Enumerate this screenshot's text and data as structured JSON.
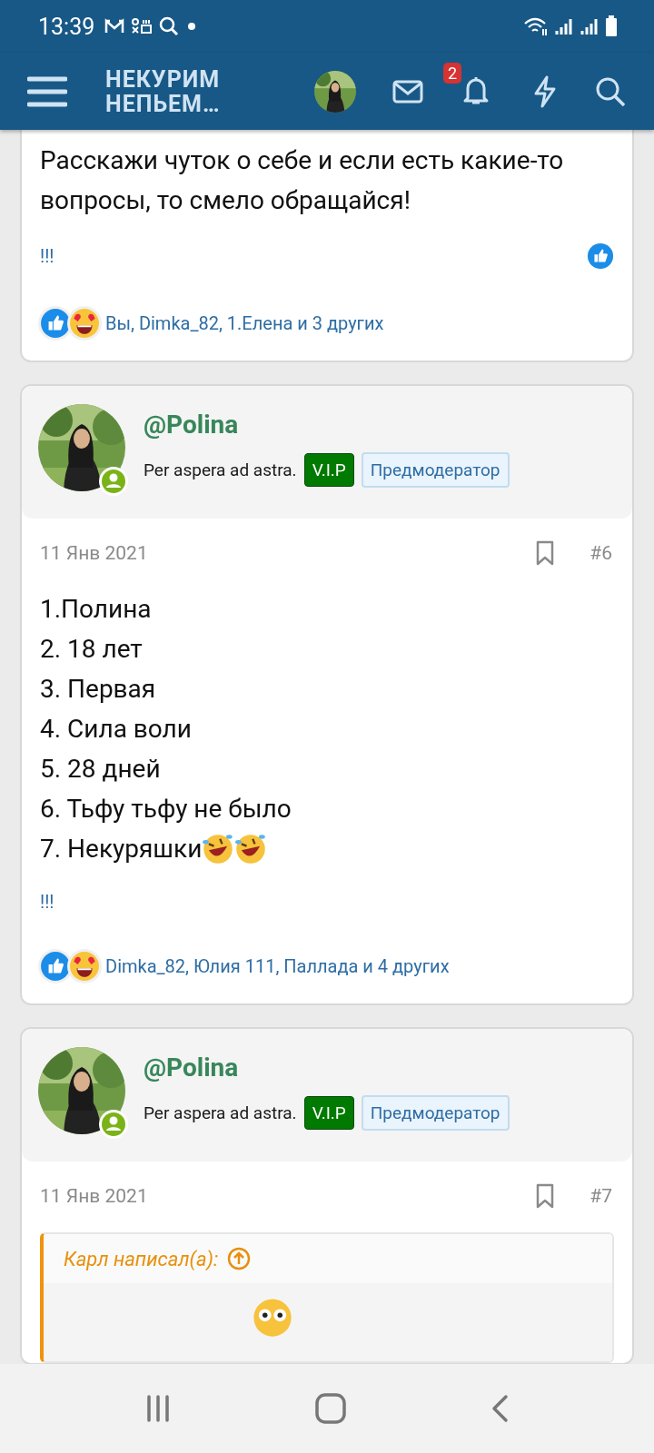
{
  "status_bar": {
    "time": "13:39"
  },
  "header": {
    "logo_lines": [
      "НЕКУРИМ",
      "НЕПЬЕМ…"
    ],
    "notification_count": "2"
  },
  "posts": [
    {
      "kind": "partial",
      "body": [
        {
          "text": "Расскажи чуток о себе и если есть какие-то вопросы, то смело обращайся!"
        }
      ],
      "signature": "!!!",
      "reacted": true,
      "reactions_text": "Вы, Dimka_82, 1.Елена и 3 других"
    },
    {
      "kind": "full",
      "author": "@Polina",
      "tagline": "Per aspera ad astra.",
      "badges": [
        {
          "label": "V.I.P",
          "kind": "vip"
        },
        {
          "label": "Предмодератор",
          "kind": "role"
        }
      ],
      "date": "11 Янв 2021",
      "number": "#6",
      "body": [
        {
          "text": "1.Полина"
        },
        {
          "text": "2. 18 лет"
        },
        {
          "text": "3. Первая"
        },
        {
          "text": "4. Сила воли"
        },
        {
          "text": "5. 28 дней"
        },
        {
          "text": "6. Тьфу тьфу не было"
        },
        {
          "text": "7. Некуряшки",
          "emoji": [
            {
              "kind": "rofl"
            },
            {
              "kind": "rofl"
            }
          ]
        }
      ],
      "signature": "!!!",
      "reacted": false,
      "reactions_text": "Dimka_82, Юлия 111, Паллада и 4 других"
    },
    {
      "kind": "full",
      "author": "@Polina",
      "tagline": "Per aspera ad astra.",
      "badges": [
        {
          "label": "V.I.P",
          "kind": "vip"
        },
        {
          "label": "Предмодератор",
          "kind": "role"
        }
      ],
      "date": "11 Янв 2021",
      "number": "#7",
      "quote": {
        "title": "Карл написал(а):",
        "emoji": [
          {
            "kind": "flushed"
          }
        ]
      }
    }
  ]
}
